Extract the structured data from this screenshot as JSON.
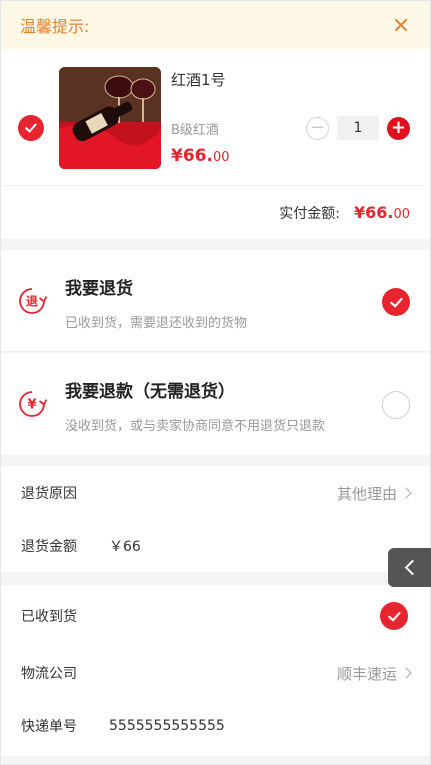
{
  "notice": {
    "text": "温馨提示:",
    "close_icon": "close-icon"
  },
  "product": {
    "title": "红酒1号",
    "spec": "B级红酒",
    "price_symbol": "¥",
    "price_int": "66.",
    "price_dec": "00",
    "quantity": "1",
    "minus_label": "−",
    "plus_label": "+"
  },
  "total": {
    "label": "实付金额:",
    "symbol": "¥",
    "int": "66.",
    "dec": "00"
  },
  "options": [
    {
      "title": "我要退货",
      "desc": "已收到货，需要退还收到的货物",
      "icon": "return-goods-icon",
      "icon_text": "退",
      "selected": true
    },
    {
      "title": "我要退款（无需退货）",
      "desc": "没收到货，或与卖家协商同意不用退货只退款",
      "icon": "refund-icon",
      "icon_text": "¥",
      "selected": false
    }
  ],
  "form": {
    "reason_label": "退货原因",
    "reason_value": "其他理由",
    "amount_label": "退货金额",
    "amount_value": "￥66",
    "received_label": "已收到货",
    "logistics_label": "物流公司",
    "logistics_value": "顺丰速运",
    "tracking_label": "快递单号",
    "tracking_value": "5555555555555"
  },
  "colors": {
    "accent": "#e6252e",
    "notice_bg": "#fdf7e6",
    "notice_text": "#e6832e"
  }
}
